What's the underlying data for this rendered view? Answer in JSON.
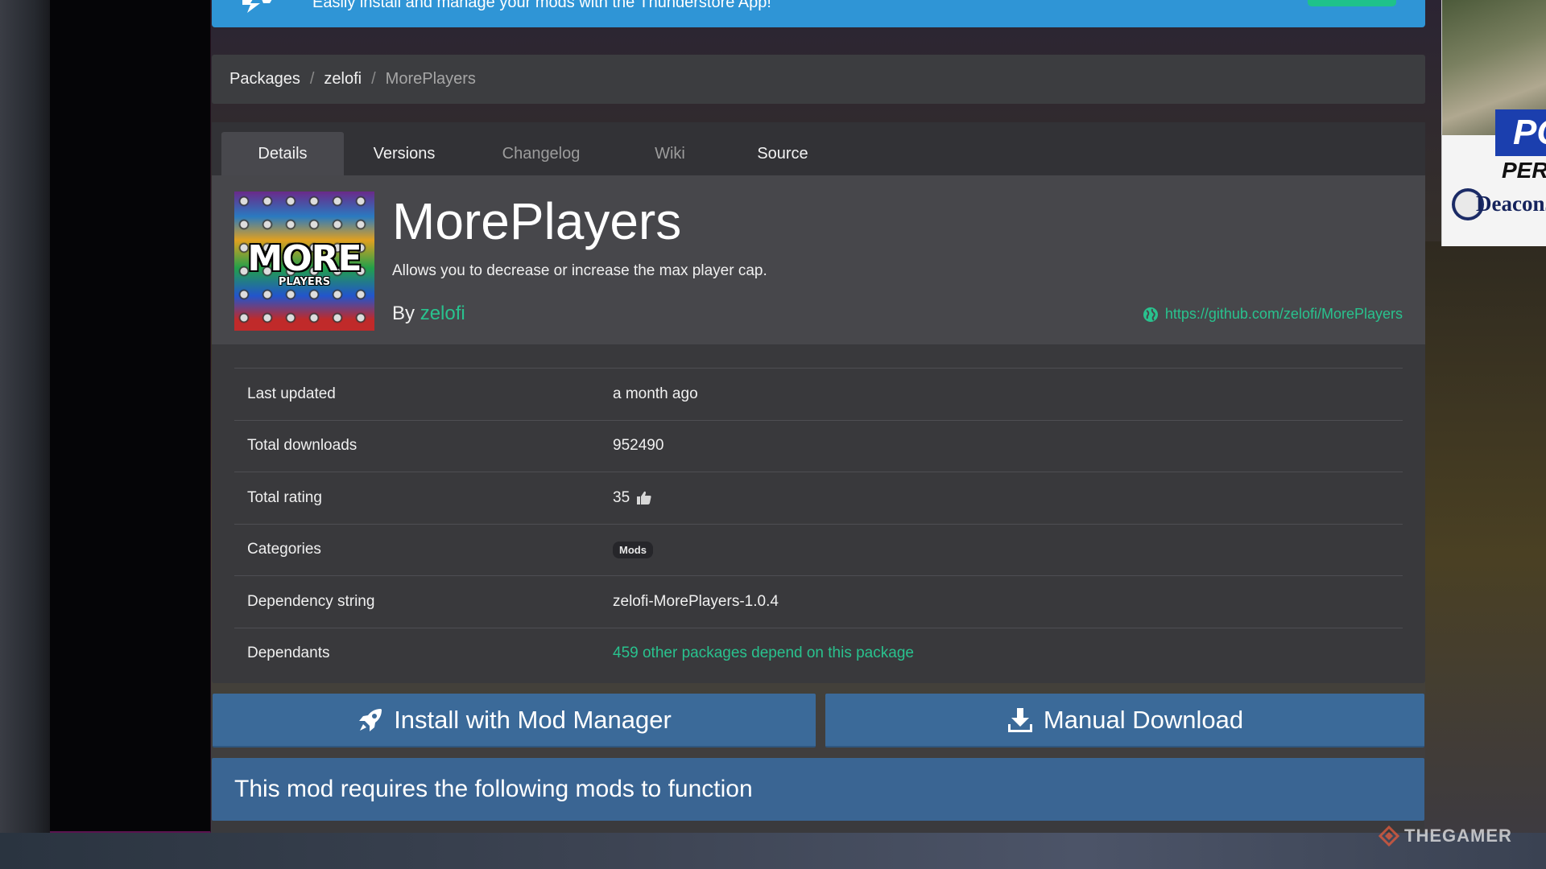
{
  "banner": {
    "text": "Easily install and manage your mods with the Thunderstore App!"
  },
  "breadcrumb": {
    "items": [
      "Packages",
      "zelofi",
      "MorePlayers"
    ],
    "separator": "/"
  },
  "tabs": [
    {
      "label": "Details",
      "active": true
    },
    {
      "label": "Versions",
      "active": false
    },
    {
      "label": "Changelog",
      "active": false
    },
    {
      "label": "Wiki",
      "active": false
    },
    {
      "label": "Source",
      "active": false
    }
  ],
  "package": {
    "icon_text": "MORE",
    "icon_subtext": "PLAYERS",
    "title": "MorePlayers",
    "description": "Allows you to decrease or increase the max player cap.",
    "by_label": "By",
    "author": "zelofi",
    "url": "https://github.com/zelofi/MorePlayers"
  },
  "details": [
    {
      "key": "Last updated",
      "value": "a month ago"
    },
    {
      "key": "Total downloads",
      "value": "952490"
    },
    {
      "key": "Total rating",
      "value": "35"
    },
    {
      "key": "Categories",
      "value": "Mods"
    },
    {
      "key": "Dependency string",
      "value": "zelofi-MorePlayers-1.0.4"
    },
    {
      "key": "Dependants",
      "value": "459 other packages depend on this package"
    }
  ],
  "buttons": {
    "install": "Install with Mod Manager",
    "download": "Manual Download"
  },
  "dependencies": {
    "heading": "This mod requires the following mods to function"
  },
  "ad": {
    "headline": "PO",
    "subline": "PER",
    "brand": "DeaconJo"
  },
  "watermark": "THEGAMER",
  "icons": {
    "banner_logo": "thunderstore-logo-icon",
    "globe": "globe-icon",
    "thumb": "thumbs-up-icon",
    "install": "rocket-icon",
    "download": "download-icon"
  },
  "colors": {
    "accent_green": "#29c28e",
    "banner_blue": "#2f95d6",
    "button_blue": "#3b6a99",
    "panel": "#39393c"
  }
}
